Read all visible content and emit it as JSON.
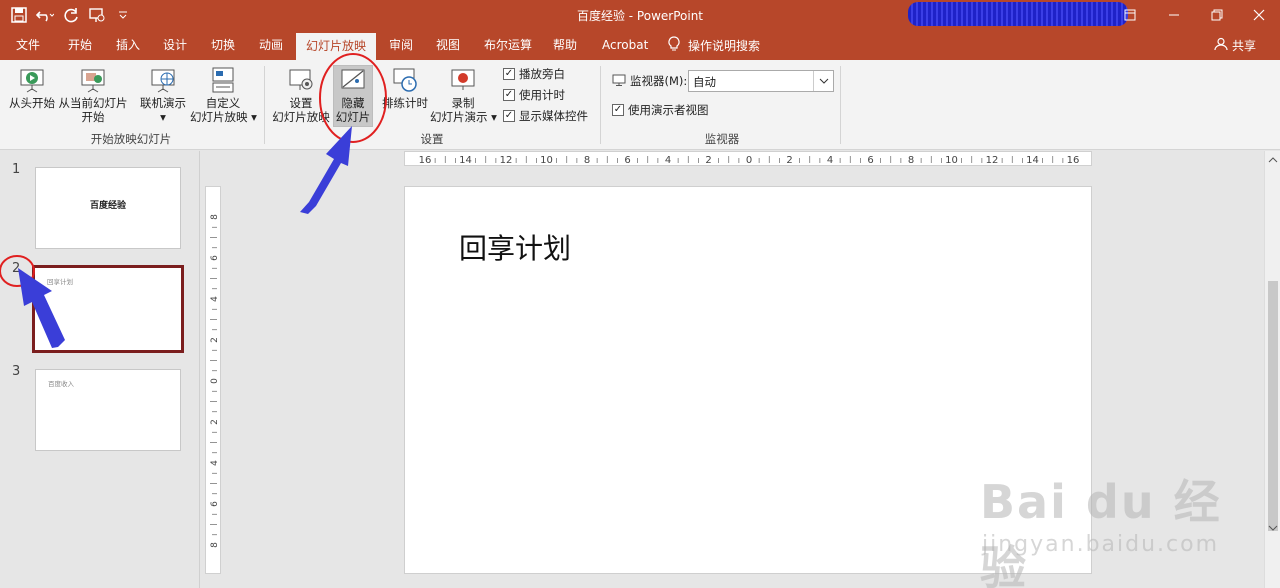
{
  "window": {
    "title": "百度经验  -  PowerPoint"
  },
  "tabs": [
    {
      "label": "文件"
    },
    {
      "label": "开始"
    },
    {
      "label": "插入"
    },
    {
      "label": "设计"
    },
    {
      "label": "切换"
    },
    {
      "label": "动画"
    },
    {
      "label": "幻灯片放映"
    },
    {
      "label": "审阅"
    },
    {
      "label": "视图"
    },
    {
      "label": "布尔运算"
    },
    {
      "label": "帮助"
    },
    {
      "label": "Acrobat"
    }
  ],
  "tell_me": "操作说明搜索",
  "share": "共享",
  "ribbon": {
    "from_beginning": "从头开始",
    "from_current": "从当前幻灯片",
    "from_current_2": "开始",
    "online": "联机演示",
    "custom": "自定义",
    "custom_2": "幻灯片放映",
    "group_start": "开始放映幻灯片",
    "setup": "设置",
    "setup_2": "幻灯片放映",
    "hide": "隐藏",
    "hide_2": "幻灯片",
    "rehearse": "排练计时",
    "record": "录制",
    "record_2": "幻灯片演示",
    "play_narrations": "播放旁白",
    "use_timings": "使用计时",
    "show_media": "显示媒体控件",
    "group_setup": "设置",
    "monitor_label": "监视器(M):",
    "monitor_value": "自动",
    "presenter_view": "使用演示者视图",
    "group_monitor": "监视器"
  },
  "slides": [
    {
      "num": "1",
      "title": "百度经验"
    },
    {
      "num": "2",
      "title": "回享计划"
    },
    {
      "num": "3",
      "title": "百度收入"
    }
  ],
  "canvas": {
    "title": "回享计划"
  },
  "hruler_labels": [
    "16",
    "14",
    "12",
    "10",
    "8",
    "6",
    "4",
    "2",
    "0",
    "2",
    "4",
    "6",
    "8",
    "10",
    "12",
    "14",
    "16"
  ],
  "vruler_labels": [
    "8",
    "6",
    "4",
    "2",
    "0",
    "2",
    "4",
    "6",
    "8"
  ],
  "watermark": {
    "main": "Bai du 经验",
    "sub": "jingyan.baidu.com"
  },
  "colors": {
    "accent": "#b7472a",
    "annotation_circle": "#e02020",
    "annotation_arrow": "#3a3ed8"
  }
}
